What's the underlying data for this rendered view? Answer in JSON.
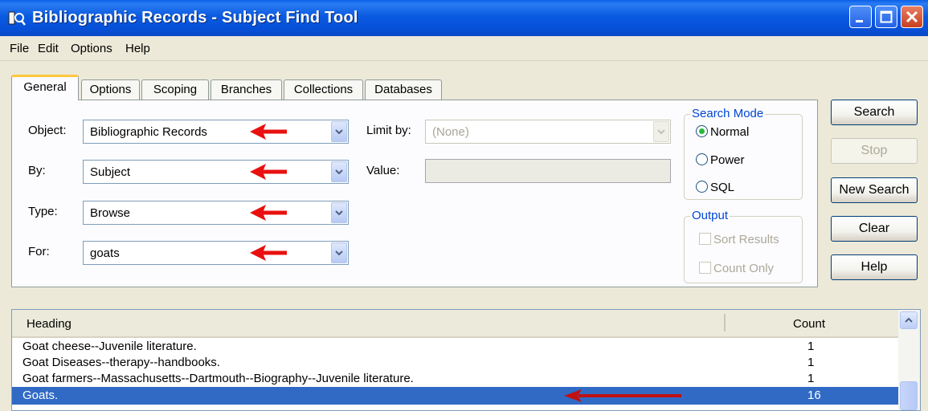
{
  "window": {
    "title": "Bibliographic Records - Subject Find Tool",
    "title_bar_color": "#0a5ae0"
  },
  "menu": {
    "items": [
      "File",
      "Edit",
      "Options",
      "Help"
    ]
  },
  "tabs": [
    {
      "label": "General",
      "active": true
    },
    {
      "label": "Options",
      "active": false
    },
    {
      "label": "Scoping",
      "active": false
    },
    {
      "label": "Branches",
      "active": false
    },
    {
      "label": "Collections",
      "active": false
    },
    {
      "label": "Databases",
      "active": false
    }
  ],
  "form": {
    "object": {
      "label": "Object:",
      "value": "Bibliographic Records"
    },
    "by": {
      "label": "By:",
      "value": "Subject"
    },
    "type": {
      "label": "Type:",
      "value": "Browse"
    },
    "for": {
      "label": "For:",
      "value": "goats"
    },
    "limit_by": {
      "label": "Limit by:",
      "value": "(None)",
      "disabled": true
    },
    "value_field": {
      "label": "Value:",
      "value": "",
      "disabled": true
    }
  },
  "search_mode": {
    "title": "Search Mode",
    "options": [
      {
        "label": "Normal",
        "selected": true
      },
      {
        "label": "Power",
        "selected": false
      },
      {
        "label": "SQL",
        "selected": false
      }
    ]
  },
  "output": {
    "title": "Output",
    "options": [
      {
        "label": "Sort Results",
        "checked": false,
        "disabled": true
      },
      {
        "label": "Count Only",
        "checked": false,
        "disabled": true
      }
    ]
  },
  "buttons": {
    "search": "Search",
    "stop": "Stop",
    "new_search": "New Search",
    "clear": "Clear",
    "help": "Help"
  },
  "results": {
    "columns": [
      "Heading",
      "Count"
    ],
    "rows": [
      {
        "heading": "Goat cheese--Juvenile literature.",
        "count": "1"
      },
      {
        "heading": "Goat Diseases--therapy--handbooks.",
        "count": "1"
      },
      {
        "heading": "Goat farmers--Massachusetts--Dartmouth--Biography--Juvenile literature.",
        "count": "1"
      },
      {
        "heading": "Goats.",
        "count": "16",
        "selected": true
      }
    ],
    "selection_color": "#316ac5"
  },
  "annotation_color": "#e8110f"
}
